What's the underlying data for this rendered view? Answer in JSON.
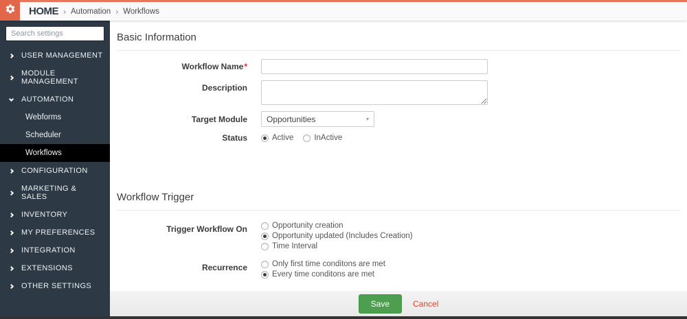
{
  "colors": {
    "accent_orange": "#e2674a",
    "sidebar_bg": "#2d3944",
    "active_item_bg": "#000000",
    "save_green": "#4e9e50",
    "cancel_red": "#e0402a"
  },
  "topbar": {
    "home_label": "HOME",
    "breadcrumb": [
      "Automation",
      "Workflows"
    ],
    "separator": "›"
  },
  "sidebar": {
    "search_placeholder": "Search settings",
    "sections": [
      {
        "label": "USER MANAGEMENT"
      },
      {
        "label": "MODULE MANAGEMENT"
      },
      {
        "label": "AUTOMATION"
      },
      {
        "label": "CONFIGURATION"
      },
      {
        "label": "MARKETING & SALES"
      },
      {
        "label": "INVENTORY"
      },
      {
        "label": "MY PREFERENCES"
      },
      {
        "label": "INTEGRATION"
      },
      {
        "label": "EXTENSIONS"
      },
      {
        "label": "OTHER SETTINGS"
      }
    ],
    "automation_children": [
      {
        "label": "Webforms",
        "active": false
      },
      {
        "label": "Scheduler",
        "active": false
      },
      {
        "label": "Workflows",
        "active": true
      }
    ]
  },
  "basic_info": {
    "title": "Basic Information",
    "workflow_name": {
      "label": "Workflow Name",
      "required_mark": "*",
      "value": ""
    },
    "description": {
      "label": "Description",
      "value": ""
    },
    "target_module": {
      "label": "Target Module",
      "selected": "Opportunities",
      "caret": "▾"
    },
    "status": {
      "label": "Status",
      "options": [
        {
          "label": "Active",
          "selected": true
        },
        {
          "label": "InActive",
          "selected": false
        }
      ]
    }
  },
  "workflow_trigger": {
    "title": "Workflow Trigger",
    "trigger_on": {
      "label": "Trigger Workflow On",
      "options": [
        {
          "label": "Opportunity creation",
          "selected": false
        },
        {
          "label": "Opportunity updated  (Includes Creation)",
          "selected": true
        },
        {
          "label": "Time Interval",
          "selected": false
        }
      ]
    },
    "recurrence": {
      "label": "Recurrence",
      "options": [
        {
          "label": "Only first time conditons are met",
          "selected": false
        },
        {
          "label": "Every time conditons are met",
          "selected": true
        }
      ]
    }
  },
  "footer": {
    "save_label": "Save",
    "cancel_label": "Cancel"
  }
}
